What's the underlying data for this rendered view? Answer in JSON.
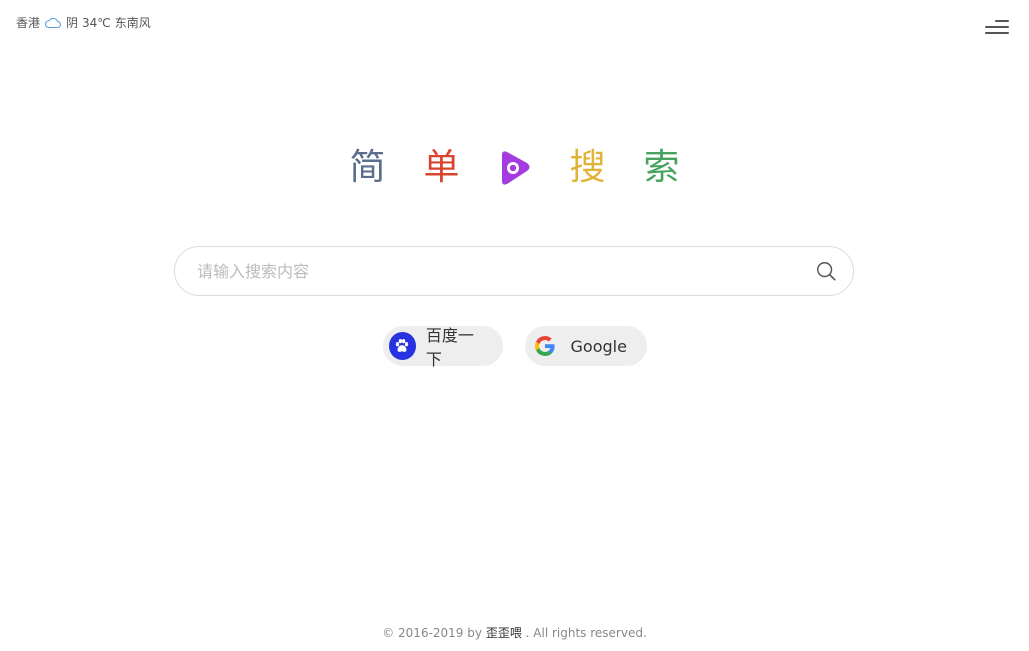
{
  "weather": {
    "city": "香港",
    "icon": "cloud-icon",
    "condition": "阴",
    "temperature": "34℃",
    "wind": "东南风"
  },
  "menu": {
    "icon": "hamburger-menu-icon"
  },
  "logo": {
    "chars": [
      {
        "text": "简",
        "color": "#5b6e8c"
      },
      {
        "text": "单",
        "color": "#d9442f"
      },
      {
        "text": "搜",
        "color": "#e0b43a"
      },
      {
        "text": "索",
        "color": "#47a35f"
      }
    ],
    "play_icon_color": "#a33be0"
  },
  "search": {
    "placeholder": "请输入搜索内容",
    "value": ""
  },
  "engines": {
    "baidu_label": "百度一下",
    "google_label": "Google"
  },
  "footer": {
    "prefix": "© 2016-2019 by",
    "author": "歪歪喂",
    "suffix": ". All rights reserved."
  }
}
